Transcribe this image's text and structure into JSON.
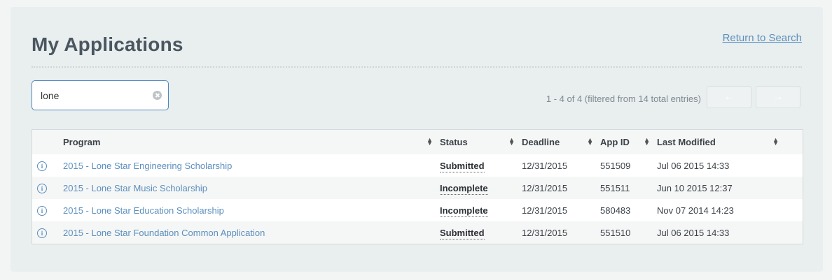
{
  "header": {
    "title": "My Applications",
    "return_link": "Return to Search"
  },
  "search": {
    "value": "lone",
    "placeholder": ""
  },
  "pager": {
    "info": "1 - 4 of 4 (filtered from 14 total entries)",
    "prev": "←",
    "next": "→"
  },
  "table": {
    "columns": [
      "Program",
      "Status",
      "Deadline",
      "App ID",
      "Last Modified"
    ],
    "rows": [
      {
        "program": "2015 - Lone Star Engineering Scholarship",
        "status": "Submitted",
        "deadline": "12/31/2015",
        "app_id": "551509",
        "modified": "Jul 06 2015 14:33"
      },
      {
        "program": "2015 - Lone Star Music Scholarship",
        "status": "Incomplete",
        "deadline": "12/31/2015",
        "app_id": "551511",
        "modified": "Jun 10 2015 12:37"
      },
      {
        "program": "2015 - Lone Star Education Scholarship",
        "status": "Incomplete",
        "deadline": "12/31/2015",
        "app_id": "580483",
        "modified": "Nov 07 2014 14:23"
      },
      {
        "program": "2015 - Lone Star Foundation Common Application",
        "status": "Submitted",
        "deadline": "12/31/2015",
        "app_id": "551510",
        "modified": "Jul 06 2015 14:33"
      }
    ]
  },
  "icons": {
    "info": "info-icon",
    "sort": "sort-icon",
    "clear": "clear-icon"
  },
  "colors": {
    "link": "#5b8fbd",
    "search_border": "#4d86bf"
  }
}
